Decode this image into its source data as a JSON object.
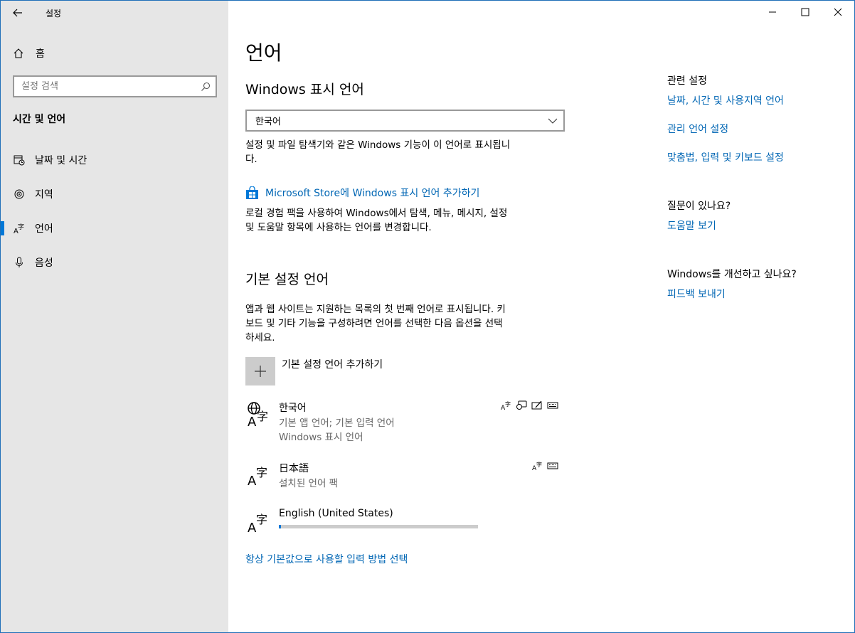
{
  "window": {
    "title": "설정"
  },
  "sidebar": {
    "home_label": "홈",
    "search_placeholder": "설정 검색",
    "section_title": "시간 및 언어",
    "items": [
      {
        "label": "날짜 및 시간",
        "icon": "calendar-clock-icon"
      },
      {
        "label": "지역",
        "icon": "globe-icon"
      },
      {
        "label": "언어",
        "icon": "language-icon",
        "selected": true
      },
      {
        "label": "음성",
        "icon": "microphone-icon"
      }
    ]
  },
  "main": {
    "title": "언어",
    "display": {
      "heading": "Windows 표시 언어",
      "selected_value": "한국어",
      "desc_line1": "설정 및 파일 탐색기와 같은 Windows 기능이 이 언어로 표시됩니",
      "desc_line2": "다.",
      "store_link": "Microsoft Store에 Windows 표시 언어 추가하기",
      "store_desc_line1": "로컬 경험 팩을 사용하여 Windows에서 탐색, 메뉴, 메시지, 설정",
      "store_desc_line2": "및 도움말 항목에 사용하는 언어를 변경합니다."
    },
    "preferred": {
      "heading": "기본 설정 언어",
      "desc_line1": "앱과 웹 사이트는 지원하는 목록의 첫 번째 언어로 표시됩니다. 키",
      "desc_line2": "보드 및 기타 기능을 구성하려면 언어를 선택한 다음 옵션을 선택",
      "desc_line3": "하세요.",
      "add_label": "기본 설정 언어 추가하기",
      "languages": [
        {
          "name": "한국어",
          "sub1": "기본 앱 언어; 기본 입력 언어",
          "sub2": "Windows 표시 언어"
        },
        {
          "name": "日本語",
          "sub1": "설치된 언어 팩"
        },
        {
          "name": "English (United States)",
          "progress": 0.01
        }
      ]
    },
    "bottom_link": "항상 기본값으로 사용할 입력 방법 선택"
  },
  "related": {
    "heading": "관련 설정",
    "links": [
      "날짜, 시간 및 사용지역 언어",
      "관리 언어 설정",
      "맞춤법, 입력 및 키보드 설정"
    ],
    "question_heading": "질문이 있나요?",
    "help_link": "도움말 보기",
    "improve_heading": "Windows를 개선하고 싶나요?",
    "feedback_link": "피드백 보내기"
  },
  "colors": {
    "accent": "#0078d7",
    "link": "#0066b4",
    "sidebar_bg": "#e6e6e6"
  }
}
